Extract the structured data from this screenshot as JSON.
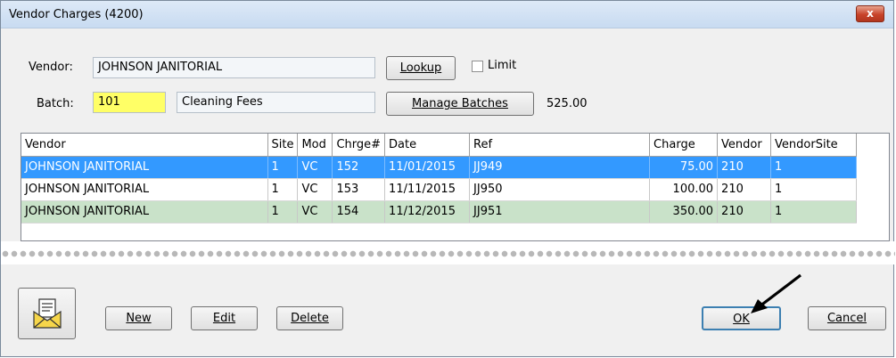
{
  "window": {
    "title": "Vendor Charges (4200)",
    "close_glyph": "x"
  },
  "form": {
    "vendor_label": "Vendor:",
    "vendor_value": "JOHNSON JANITORIAL",
    "lookup_label": "Lookup",
    "limit_label": "Limit",
    "limit_checked": false,
    "batch_label": "Batch:",
    "batch_value": "101",
    "batch_name": "Cleaning Fees",
    "manage_batches_label": "Manage Batches",
    "batch_total": "525.00"
  },
  "grid": {
    "columns": [
      "Vendor",
      "Site",
      "Mod",
      "Chrge#",
      "Date",
      "Ref",
      "Charge",
      "Vendor",
      "VendorSite"
    ],
    "rows": [
      [
        "JOHNSON JANITORIAL",
        "1",
        "VC",
        "152",
        "11/01/2015",
        "JJ949",
        "75.00",
        "210",
        "1"
      ],
      [
        "JOHNSON JANITORIAL",
        "1",
        "VC",
        "153",
        "11/11/2015",
        "JJ950",
        "100.00",
        "210",
        "1"
      ],
      [
        "JOHNSON JANITORIAL",
        "1",
        "VC",
        "154",
        "11/12/2015",
        "JJ951",
        "350.00",
        "210",
        "1"
      ]
    ],
    "selected_row": 0
  },
  "buttons": {
    "mail_icon": "envelope-document-icon",
    "new_label": "New",
    "edit_label": "Edit",
    "delete_label": "Delete",
    "ok_label": "OK",
    "cancel_label": "Cancel"
  },
  "colors": {
    "selection": "#3399ff",
    "alt_row": "#c9e2c9",
    "batch_highlight": "#ffff66",
    "title_bar": "#d3e3f5"
  }
}
